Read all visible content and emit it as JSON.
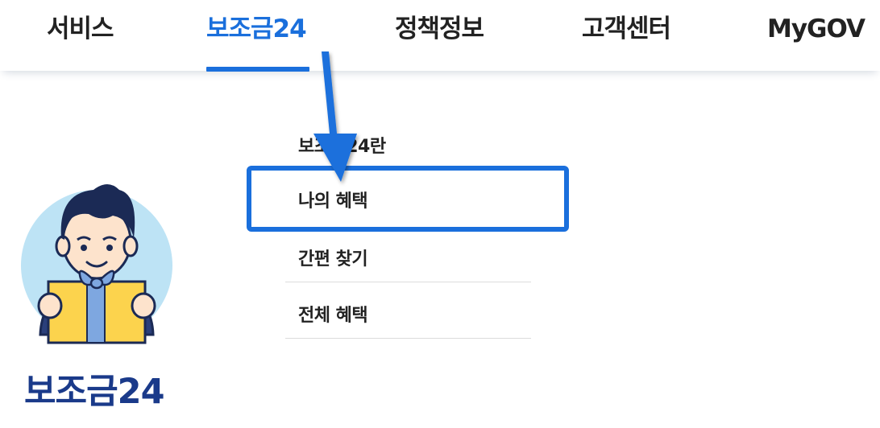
{
  "nav": {
    "items": [
      {
        "label": "서비스"
      },
      {
        "label": "보조금24"
      },
      {
        "label": "정책정보"
      },
      {
        "label": "고객센터"
      },
      {
        "label": "MyGOV"
      }
    ],
    "active_index": 1
  },
  "submenu": {
    "items": [
      {
        "label": "보조금24란"
      },
      {
        "label": "나의 혜택"
      },
      {
        "label": "간편 찾기"
      },
      {
        "label": "전체 혜택"
      }
    ],
    "highlighted_index": 1
  },
  "brand": {
    "title": "보조금24",
    "mascot_icon": "gift-holding-person-icon"
  },
  "colors": {
    "accent": "#1a6fdc",
    "brand_text": "#1a3a8a",
    "text": "#222222"
  }
}
